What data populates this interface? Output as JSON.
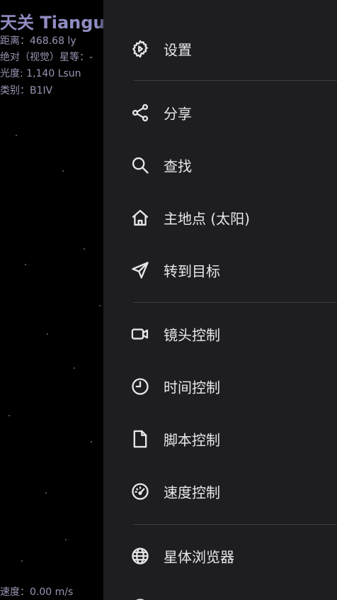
{
  "object_info": {
    "name": "天关 Tiangu",
    "distance": "距离：468.68 ly",
    "magnitude": "绝对（视觉）星等：-",
    "luminosity": "光度: 1,140 Lsun",
    "type": "类别：B1IV"
  },
  "status": {
    "speed": "速度：0.00 m/s"
  },
  "menu": {
    "settings": "设置",
    "share": "分享",
    "search": "查找",
    "home": "主地点 (太阳)",
    "goto": "转到目标",
    "camera": "镜头控制",
    "time": "时间控制",
    "script": "脚本控制",
    "speed": "速度控制",
    "browser": "星体浏览器"
  },
  "colors": {
    "drawer_bg": "#1e1e22",
    "text": "#e8e8ec",
    "info_text": "#9796b4",
    "title_text": "#8e8cc0"
  },
  "icons": [
    "settings-icon",
    "share-icon",
    "search-icon",
    "home-icon",
    "navigate-icon",
    "video-camera-icon",
    "clock-icon",
    "document-icon",
    "speedometer-icon",
    "globe-icon"
  ]
}
